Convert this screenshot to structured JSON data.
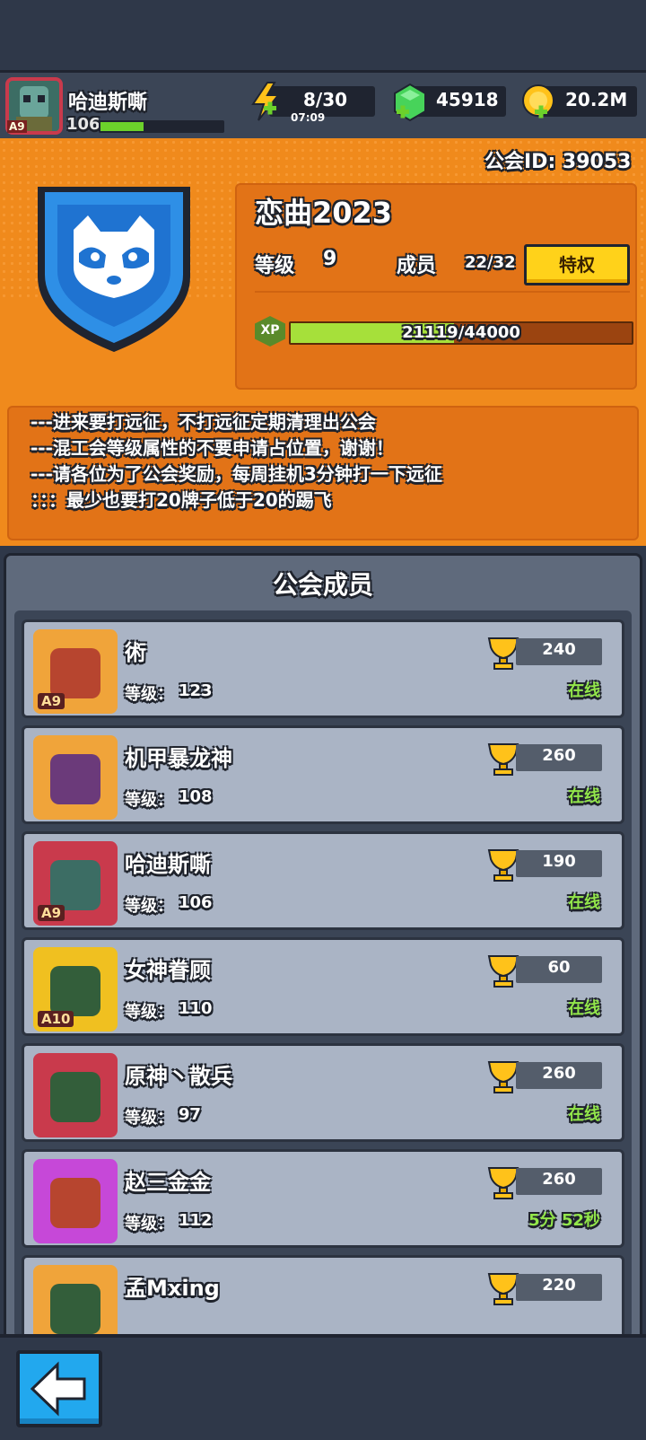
{
  "player": {
    "name": "哈迪斯嘶",
    "level": "106",
    "rank_badge": "A9",
    "xp_fraction": 0.35
  },
  "resources": {
    "energy": {
      "value": "8/30",
      "timer": "07:09",
      "icon": "lightning-icon",
      "color": "#ffc21a"
    },
    "gems": {
      "value": "45918",
      "icon": "green-gem-icon",
      "color": "#47d35a"
    },
    "coins": {
      "value": "20.2M",
      "icon": "gold-coin-icon",
      "color": "#ffc21a"
    }
  },
  "guild": {
    "id_text": "公会ID: 39053",
    "name": "恋曲2023",
    "level_label": "等级",
    "level": "9",
    "members_label": "成员",
    "members_count": "22/32",
    "privilege_label": "特权",
    "xp_badge": "XP",
    "xp_text": "21119/44000",
    "xp_current": 21119,
    "xp_max": 44000,
    "emblem_icon": "raccoon-shield-icon",
    "notice": [
      "---进来要打远征，不打远征定期清理出公会",
      "---混工会等级属性的不要申请占位置，谢谢！",
      "---请各位为了公会奖励，每周挂机3分钟打一下远征",
      "：：：最少也要打20牌子低于20的踢飞"
    ]
  },
  "members_section": {
    "title": "公会成员",
    "level_prefix": "等级：",
    "members": [
      {
        "name": "術",
        "level": "123",
        "trophies": "240",
        "status": "在线",
        "rank": "A9",
        "frame_color": "#f0a43a",
        "face_color": "#b7452f"
      },
      {
        "name": "机甲暴龙神",
        "level": "108",
        "trophies": "260",
        "status": "在线",
        "rank": "",
        "frame_color": "#f0a43a",
        "face_color": "#6b3a7a"
      },
      {
        "name": "哈迪斯嘶",
        "level": "106",
        "trophies": "190",
        "status": "在线",
        "rank": "A9",
        "frame_color": "#c93a4c",
        "face_color": "#3c6d64"
      },
      {
        "name": "女神眷顾",
        "level": "110",
        "trophies": "60",
        "status": "在线",
        "rank": "A10",
        "frame_color": "#f0c020",
        "face_color": "#335e3a"
      },
      {
        "name": "原神丶散兵",
        "level": "97",
        "trophies": "260",
        "status": "在线",
        "rank": "",
        "frame_color": "#c93a4c",
        "face_color": "#335e3a"
      },
      {
        "name": "赵三金金",
        "level": "112",
        "trophies": "260",
        "status": "5分 52秒",
        "rank": "",
        "frame_color": "#c648d8",
        "face_color": "#b7452f"
      },
      {
        "name": "孟Mxing",
        "level": "",
        "trophies": "220",
        "status": "",
        "rank": "",
        "frame_color": "#f0a43a",
        "face_color": "#335e3a"
      }
    ]
  },
  "navigation": {
    "back_icon": "back-arrow-icon"
  }
}
